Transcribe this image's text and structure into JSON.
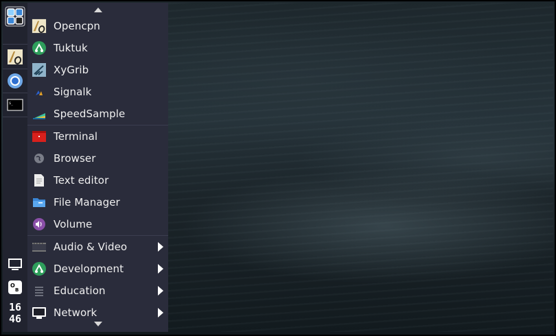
{
  "clock": {
    "hour": "16",
    "minute": "46"
  },
  "menu": {
    "favorites": [
      {
        "label": "Opencpn",
        "icon": "opencpn-icon"
      },
      {
        "label": "Tuktuk",
        "icon": "tuktuk-icon"
      },
      {
        "label": "XyGrib",
        "icon": "xygrib-icon"
      },
      {
        "label": "Signalk",
        "icon": "signalk-icon"
      },
      {
        "label": "SpeedSample",
        "icon": "speedsample-icon"
      }
    ],
    "system": [
      {
        "label": "Terminal",
        "icon": "terminal-icon"
      },
      {
        "label": "Browser",
        "icon": "browser-icon"
      },
      {
        "label": "Text editor",
        "icon": "text-editor-icon"
      },
      {
        "label": "File Manager",
        "icon": "file-manager-icon"
      },
      {
        "label": "Volume",
        "icon": "volume-icon"
      }
    ],
    "categories": [
      {
        "label": "Audio & Video",
        "icon": "audio-video-icon"
      },
      {
        "label": "Development",
        "icon": "development-icon"
      },
      {
        "label": "Education",
        "icon": "education-icon"
      },
      {
        "label": "Network",
        "icon": "network-icon"
      }
    ]
  },
  "colors": {
    "dock": "#21232f",
    "menu": "#2a2c3b",
    "accent_blue": "#3a86d6",
    "green": "#2e9e5b",
    "red": "#d8201c"
  }
}
